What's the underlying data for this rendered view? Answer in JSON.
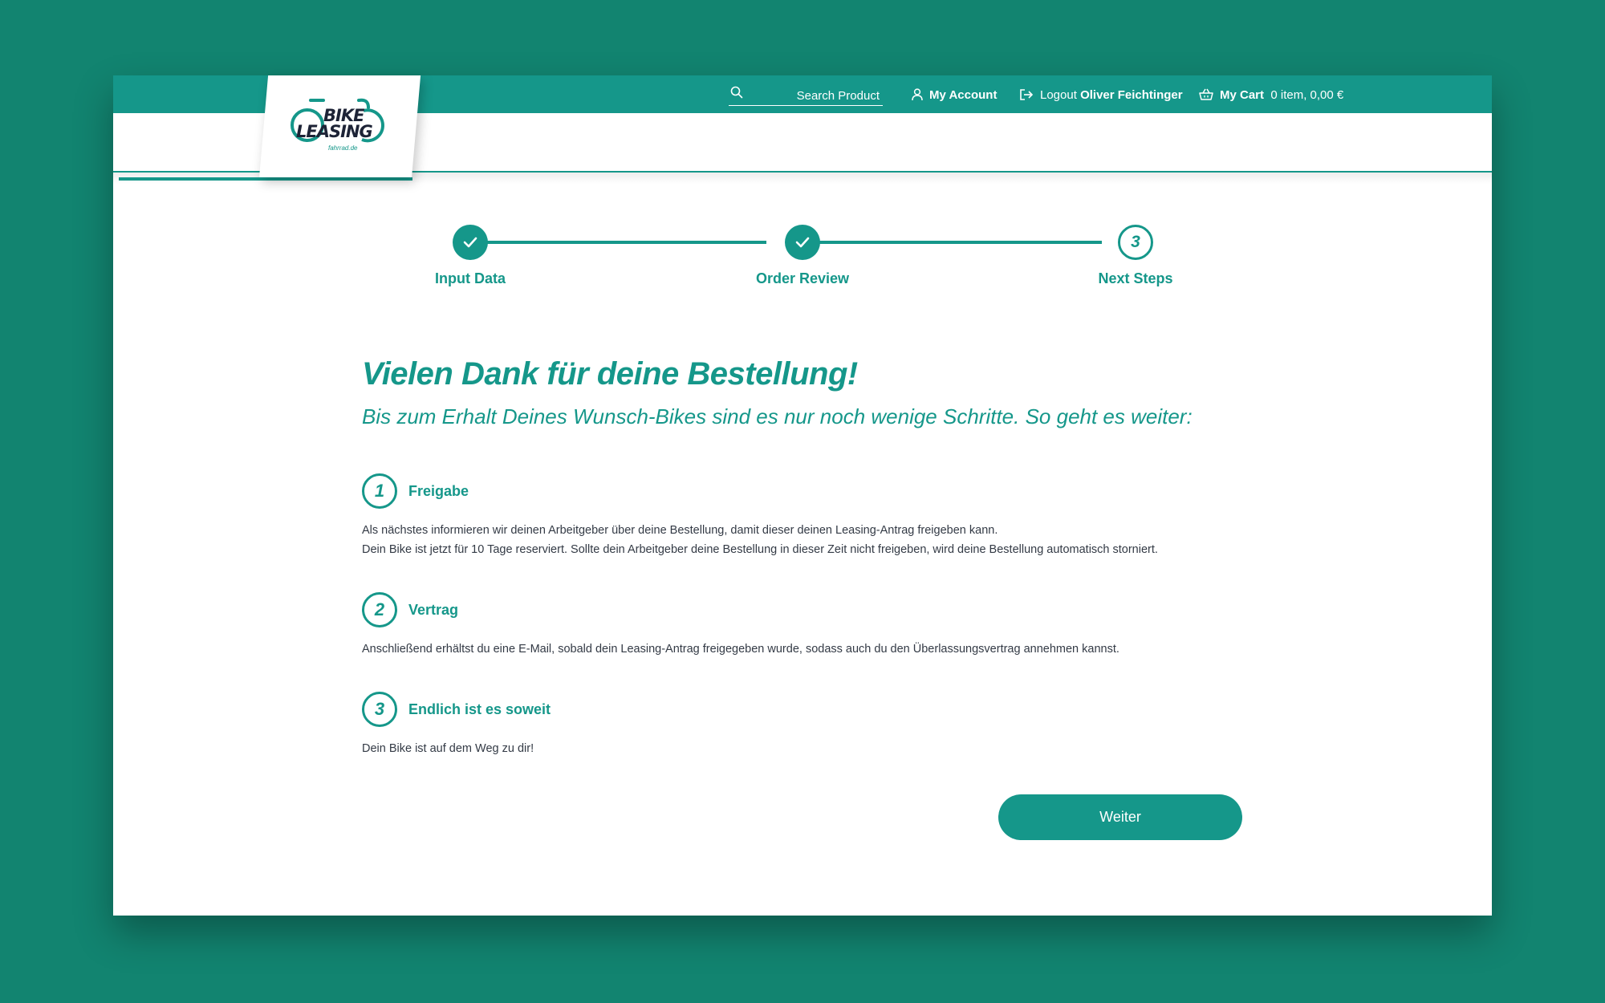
{
  "brand": {
    "logo_line1": "BIKE",
    "logo_line2": "LEASING",
    "logo_small": "fahrrad.de",
    "accent_color": "#15978a",
    "background_color": "#128470"
  },
  "topnav": {
    "search_placeholder": "Search Product",
    "account_label": "My Account",
    "logout_label": "Logout",
    "user_name": "Oliver Feichtinger",
    "cart_label": "My Cart",
    "cart_summary": "0 item, 0,00 €",
    "icons": [
      "search-icon",
      "user-icon",
      "logout-icon",
      "basket-icon"
    ]
  },
  "stepper": {
    "steps": [
      {
        "label": "Input Data",
        "status": "done",
        "icon": "checkmark-icon"
      },
      {
        "label": "Order Review",
        "status": "done",
        "icon": "checkmark-icon"
      },
      {
        "label": "Next Steps",
        "status": "current",
        "number": "3"
      }
    ]
  },
  "content": {
    "title": "Vielen Dank für deine Bestellung!",
    "subtitle": "Bis zum Erhalt Deines Wunsch-Bikes sind es nur noch wenige Schritte. So geht es weiter:",
    "sections": [
      {
        "number": "1",
        "heading": "Freigabe",
        "lines": [
          "Als nächstes informieren wir deinen Arbeitgeber über deine Bestellung, damit dieser deinen Leasing-Antrag freigeben kann.",
          "Dein Bike ist jetzt für 10 Tage reserviert. Sollte dein Arbeitgeber deine Bestellung in dieser Zeit nicht freigeben, wird deine Bestellung automatisch storniert."
        ]
      },
      {
        "number": "2",
        "heading": "Vertrag",
        "lines": [
          "Anschließend erhältst du eine E-Mail, sobald dein Leasing-Antrag freigegeben wurde, sodass auch du den Überlassungsvertrag annehmen kannst."
        ]
      },
      {
        "number": "3",
        "heading": "Endlich ist es soweit",
        "lines": [
          "Dein Bike ist auf dem Weg zu dir!"
        ]
      }
    ],
    "button_label": "Weiter"
  }
}
